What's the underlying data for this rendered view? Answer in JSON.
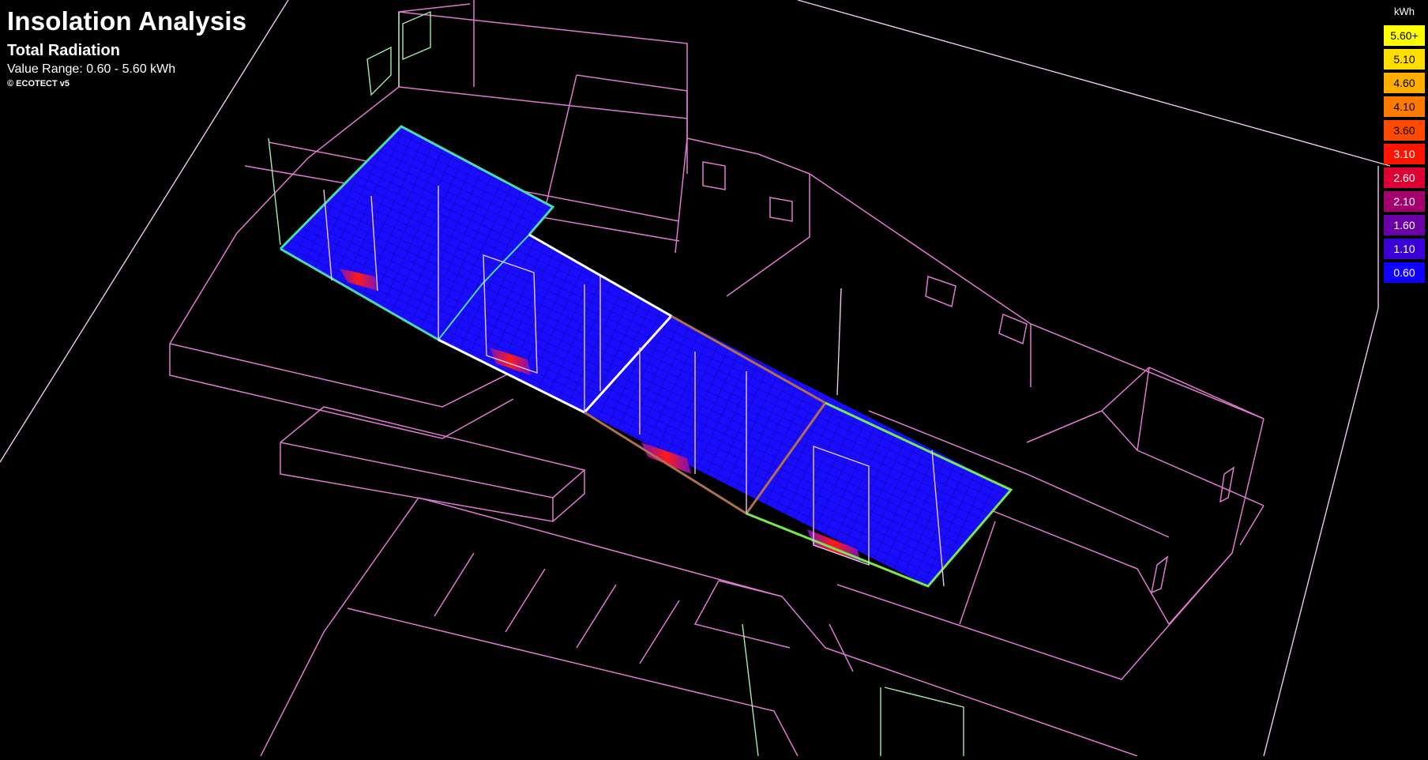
{
  "title": {
    "main": "Insolation Analysis",
    "sub": "Total Radiation",
    "range": "Value Range: 0.60 - 5.60 kWh",
    "credit": "© ECOTECT v5"
  },
  "legend": {
    "unit": "kWh",
    "items": [
      {
        "label": "5.60+",
        "color": "#ffff00",
        "text_color": "#000000"
      },
      {
        "label": "5.10",
        "color": "#ffde00",
        "text_color": "#000000"
      },
      {
        "label": "4.60",
        "color": "#ffae00",
        "text_color": "#000000"
      },
      {
        "label": "4.10",
        "color": "#ff7a00",
        "text_color": "#000000"
      },
      {
        "label": "3.60",
        "color": "#ff4a00",
        "text_color": "#000000"
      },
      {
        "label": "3.10",
        "color": "#ff1400",
        "text_color": "#ffffff"
      },
      {
        "label": "2.60",
        "color": "#dd0033",
        "text_color": "#ffffff"
      },
      {
        "label": "2.10",
        "color": "#a4006e",
        "text_color": "#ffffff"
      },
      {
        "label": "1.60",
        "color": "#6a00a6",
        "text_color": "#ffffff"
      },
      {
        "label": "1.10",
        "color": "#3a00d6",
        "text_color": "#ffffff"
      },
      {
        "label": "0.60",
        "color": "#0f00ff",
        "text_color": "#ffffff"
      }
    ]
  },
  "colors": {
    "background": "#000000",
    "wireframe": "#e07ad0",
    "wireframe_light": "#f0b0e0",
    "analysis_grid": "#1a0cff",
    "outline_teal": "#4cd8b0",
    "outline_white": "#ffffff",
    "outline_green": "#78e850",
    "outline_brown": "#b07050",
    "hot_spot": "#ff1a1a"
  }
}
